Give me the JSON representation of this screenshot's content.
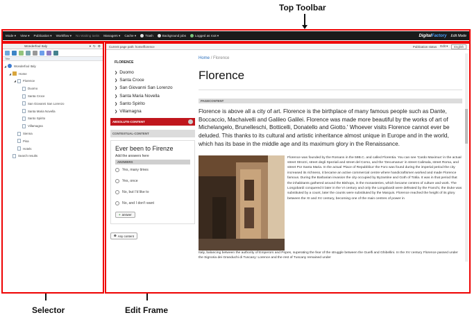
{
  "callouts": {
    "top_toolbar": "Top Toolbar",
    "selector": "Selector",
    "edit_frame": "Edit Frame"
  },
  "toolbar": {
    "items": [
      "Mode ▾",
      "View ▾",
      "Publication ▾",
      "Workflow ▾",
      "No Waiting tasks",
      "Managers ▾",
      "Cache ▾",
      "Trash",
      "Background jobs",
      "Logged as root ▾"
    ],
    "brand_left": "Digital",
    "brand_right": "Factory",
    "mode": "Edit Mode"
  },
  "selector": {
    "site": "Wonderfoul Italy",
    "column_title": "Title",
    "tree": [
      {
        "label": "Wonderfoul Italy",
        "level": 0,
        "icon": "globe-icon"
      },
      {
        "label": "Home",
        "level": 1,
        "icon": "home-icon"
      },
      {
        "label": "Florence",
        "level": 2,
        "icon": "page-icon"
      },
      {
        "label": "Duomo",
        "level": 3,
        "icon": "page-icon"
      },
      {
        "label": "Santa Croce",
        "level": 3,
        "icon": "page-icon"
      },
      {
        "label": "San Giovanni San Lorenzo",
        "level": 3,
        "icon": "page-icon"
      },
      {
        "label": "Santa Maria Novella",
        "level": 3,
        "icon": "page-icon"
      },
      {
        "label": "Santo Spirito",
        "level": 3,
        "icon": "page-icon"
      },
      {
        "label": "Villamagna",
        "level": 3,
        "icon": "page-icon"
      },
      {
        "label": "Sienna",
        "level": 2,
        "icon": "page-icon"
      },
      {
        "label": "Pisa",
        "level": 2,
        "icon": "page-icon"
      },
      {
        "label": "Hotels",
        "level": 2,
        "icon": "page-icon"
      },
      {
        "label": "Search results",
        "level": 1,
        "icon": "page-icon"
      }
    ]
  },
  "editframe": {
    "path": "Current page path: home/florence",
    "publication_status": "Publication status",
    "edit": "Edit ▾",
    "language": "English",
    "nav_heading": "FLORENCE",
    "nav": [
      "Duomo",
      "Santa Croce",
      "San Giovanni San Lorenzo",
      "Santa Maria Novella",
      "Santo Spirito",
      "Villamagna"
    ],
    "absolute_area": "ABSOLUTE-CONTENT",
    "contextual_area": "CONTEXTUAL-CONTENT",
    "quiz": {
      "title": "Ever been to Firenze",
      "subtitle": "Add the answers here",
      "header": "ANSWERS",
      "options": [
        "Yes, many times",
        "Yes, once",
        "No, but I'd like to",
        "No, and I don't want"
      ],
      "answer_button": "answer"
    },
    "any_content": "Any content",
    "crumb_home": "Home",
    "crumb_sep": "/",
    "crumb_current": "Florence",
    "title": "Florence",
    "pagecontent": "PAGECONTENT",
    "lead": "Florence is above all a city of art. Florence is the birthplace of many famous people such as Dante, Boccaccio, Machaivelli and Galileo Galilei. Florence was made more beautiful by the works of art of Michelangelo, Brunelleschi, Botticelli, Donatello and Giotto.' Whoever visits Florence cannot ever be deluded. This thanks to its cultural and artistic inheritance almost unique in Europe and in the world, which has its base in the middle age and its maximum glory in the Renaissance.",
    "body_side": "Florence was founded by the Romans in the 59B.C. and called Florentia. You can see 'Cardo Maximus' in the actual street Strozzi, street degli Speziali and street del Corso, and the 'Decumanus' in street Calimala, street Roma, and street Por Santa Maria. In the actual 'Piace of Repubblica' the Foro was found during the imperial period the city increased its richness, it became an active commercial centre where handicraftsmen worked and made Florence famous. During the Barbarian invasion the city occupied by Byzantine and Goth of Totila. It was in that period that the inhabitants gathered around the Bishops, in the monasteries, which became centres of culture and work. The Longobardi conquered it later in the VI century and only the Longobardi were defeated by the Franchi, the Duke was substituted by a count, later the counts were substituted by the Marquis. Florence reached the height of its glory between the XI and XV century, becoming one of the main centres of power in",
    "body_full": "Italy, balancing between the authority of Emperors and Popes, superating the fear of the struggle between the Guelfi and Ghibellini. In the XV century Florence passed under the Signoria dei Granduchi di Tuscany: Lorence and the rest of Tuscany remained under"
  }
}
